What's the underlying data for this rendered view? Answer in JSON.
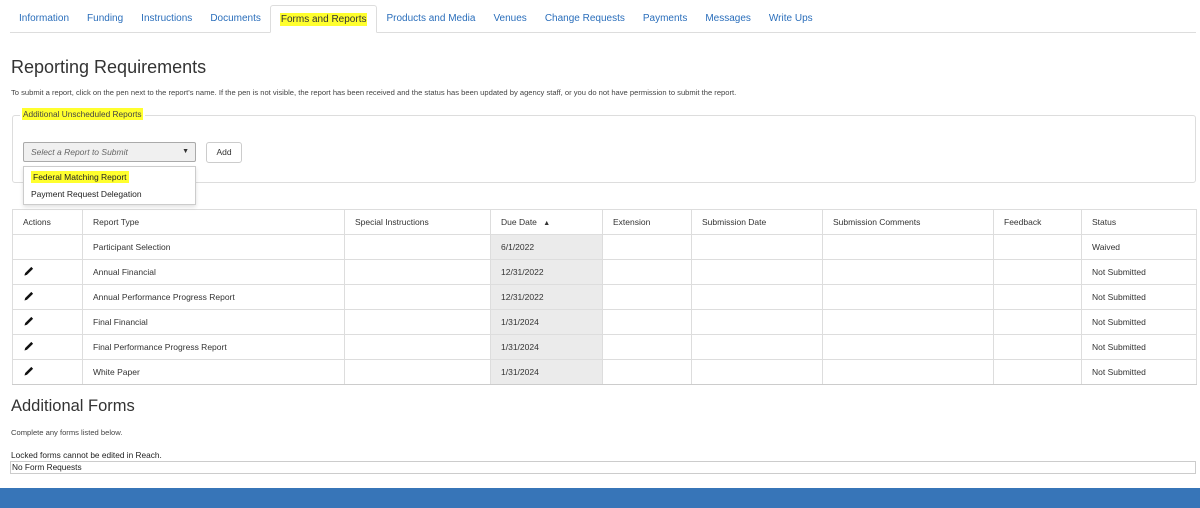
{
  "tabs": [
    {
      "label": "Information"
    },
    {
      "label": "Funding"
    },
    {
      "label": "Instructions"
    },
    {
      "label": "Documents"
    },
    {
      "label": "Forms and Reports",
      "active": true
    },
    {
      "label": "Products and Media"
    },
    {
      "label": "Venues"
    },
    {
      "label": "Change Requests"
    },
    {
      "label": "Payments"
    },
    {
      "label": "Messages"
    },
    {
      "label": "Write Ups"
    }
  ],
  "reporting": {
    "title": "Reporting Requirements",
    "intro": "To submit a report, click on the pen next to the report's name. If the pen is not visible, the report has been received and the status has been updated by agency staff, or you do not have permission to submit the report."
  },
  "unscheduled": {
    "legend": "Additional Unscheduled Reports",
    "select_placeholder": "Select a Report to Submit",
    "add_label": "Add",
    "options": [
      "Federal Matching Report",
      "Payment Request Delegation"
    ]
  },
  "table": {
    "headers": {
      "actions": "Actions",
      "report_type": "Report Type",
      "special": "Special Instructions",
      "due": "Due Date",
      "extension": "Extension",
      "submission_date": "Submission Date",
      "submission_comments": "Submission Comments",
      "feedback": "Feedback",
      "status": "Status"
    },
    "sort_indicator": "▲",
    "rows": [
      {
        "editable": false,
        "report_type": "Participant Selection",
        "due": "6/1/2022",
        "status": "Waived"
      },
      {
        "editable": true,
        "report_type": "Annual Financial",
        "due": "12/31/2022",
        "status": "Not Submitted"
      },
      {
        "editable": true,
        "report_type": "Annual Performance Progress Report",
        "due": "12/31/2022",
        "status": "Not Submitted"
      },
      {
        "editable": true,
        "report_type": "Final Financial",
        "due": "1/31/2024",
        "status": "Not Submitted"
      },
      {
        "editable": true,
        "report_type": "Final Performance Progress Report",
        "due": "1/31/2024",
        "status": "Not Submitted"
      },
      {
        "editable": true,
        "report_type": "White Paper",
        "due": "1/31/2024",
        "status": "Not Submitted"
      }
    ]
  },
  "forms": {
    "title": "Additional Forms",
    "complete_text": "Complete any forms listed below.",
    "locked_text": "Locked forms cannot be edited in Reach.",
    "no_forms": "No Form Requests"
  },
  "colors": {
    "link": "#2a6ebb",
    "highlight": "#ffff2e",
    "footer": "#3775b8",
    "due_col_bg": "#ebebeb"
  }
}
